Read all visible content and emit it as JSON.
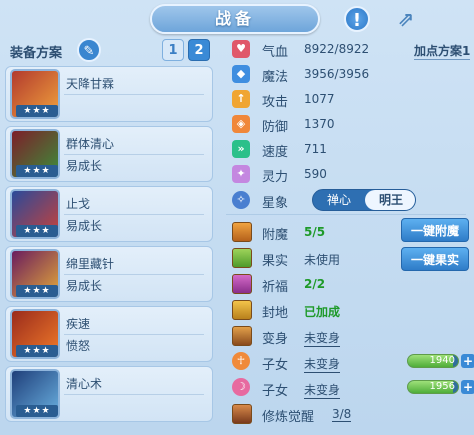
{
  "title": "战备",
  "header": {
    "info_icon": "exclamation-icon",
    "share_icon": "share-arrow-icon"
  },
  "schemes": {
    "label": "装备方案",
    "buttons": [
      "1",
      "2"
    ],
    "active": "2"
  },
  "cards": [
    {
      "name": "天降甘霖",
      "sub": "",
      "stars": "★★★"
    },
    {
      "name": "群体清心",
      "sub": "易成长",
      "stars": "★★★"
    },
    {
      "name": "止戈",
      "sub": "易成长",
      "stars": "★★★"
    },
    {
      "name": "绵里藏针",
      "sub": "易成长",
      "stars": "★★★"
    },
    {
      "name": "疾速",
      "sub": "愤怒",
      "stars": "★★★"
    },
    {
      "name": "清心术",
      "sub": "",
      "stars": "★★★"
    }
  ],
  "plan_button": "加点方案1",
  "stats": [
    {
      "label": "气血",
      "value": "8922/8922",
      "color": "#e0586a",
      "icon": "♥"
    },
    {
      "label": "魔法",
      "value": "3956/3956",
      "color": "#3f8ee0",
      "icon": "◆"
    },
    {
      "label": "攻击",
      "value": "1077",
      "color": "#f0a532",
      "icon": "↑"
    },
    {
      "label": "防御",
      "value": "1370",
      "color": "#f0873a",
      "icon": "◈"
    },
    {
      "label": "速度",
      "value": "711",
      "color": "#2bc08a",
      "icon": "»"
    },
    {
      "label": "灵力",
      "value": "590",
      "color": "#c487e0",
      "icon": "✦"
    }
  ],
  "star_image": {
    "label": "星象",
    "options": [
      "禅心",
      "明王"
    ],
    "selected": "明王"
  },
  "attrs": [
    {
      "label": "附魔",
      "value": "5/5",
      "style": "green"
    },
    {
      "label": "果实",
      "value": "未使用",
      "style": "plain"
    },
    {
      "label": "祈福",
      "value": "2/2",
      "style": "green"
    },
    {
      "label": "封地",
      "value": "已加成",
      "style": "green"
    },
    {
      "label": "变身",
      "value": "未变身",
      "style": "uline"
    },
    {
      "label": "子女",
      "value": "未变身",
      "style": "uline"
    },
    {
      "label": "子女",
      "value": "未变身",
      "style": "uline"
    },
    {
      "label": "修炼觉醒",
      "value": "3/8",
      "style": "uline"
    }
  ],
  "buttons": {
    "enchant": "一键附魔",
    "fruit": "一键果实"
  },
  "children_bars": [
    {
      "value": "1940",
      "fill": 0.9
    },
    {
      "value": "1956",
      "fill": 0.9
    }
  ]
}
